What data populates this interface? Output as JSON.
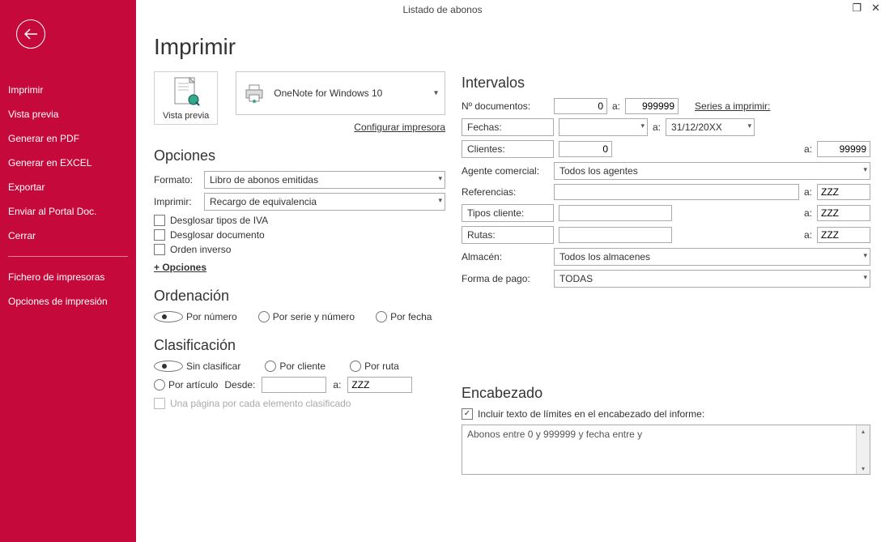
{
  "window": {
    "title": "Listado de abonos"
  },
  "sidebar": {
    "items": [
      "Imprimir",
      "Vista previa",
      "Generar en PDF",
      "Generar en EXCEL",
      "Exportar",
      "Enviar al Portal Doc.",
      "Cerrar"
    ],
    "secondary": [
      "Fichero de impresoras",
      "Opciones de impresión"
    ]
  },
  "page": {
    "title": "Imprimir",
    "preview_label": "Vista previa",
    "printer_name": "OneNote for Windows 10",
    "configure_printer": "Configurar impresora"
  },
  "opciones": {
    "title": "Opciones",
    "formato_label": "Formato:",
    "formato_value": "Libro de abonos emitidas",
    "imprimir_label": "Imprimir:",
    "imprimir_value": "Recargo de equivalencia",
    "chk1": "Desglosar tipos de IVA",
    "chk2": "Desglosar documento",
    "chk3": "Orden inverso",
    "more": "+ Opciones"
  },
  "ordenacion": {
    "title": "Ordenación",
    "r1": "Por número",
    "r2": "Por serie y número",
    "r3": "Por fecha"
  },
  "clasificacion": {
    "title": "Clasificación",
    "r1": "Sin clasificar",
    "r2": "Por cliente",
    "r3": "Por ruta",
    "r4": "Por artículo",
    "desde": "Desde:",
    "a": "a:",
    "hasta_val": "ZZZ",
    "chk_page": "Una página por cada elemento clasificado"
  },
  "intervalos": {
    "title": "Intervalos",
    "ndoc_label": "Nº documentos:",
    "ndoc_from": "0",
    "ndoc_to": "999999",
    "series_link": "Series a imprimir:",
    "fechas_label": "Fechas:",
    "fechas_to": "31/12/20XX",
    "clientes_label": "Clientes:",
    "clientes_from": "0",
    "clientes_to": "99999",
    "agente_label": "Agente comercial:",
    "agente_value": "Todos los agentes",
    "ref_label": "Referencias:",
    "ref_to": "ZZZ",
    "tipos_label": "Tipos cliente:",
    "tipos_to": "ZZZ",
    "rutas_label": "Rutas:",
    "rutas_to": "ZZZ",
    "almacen_label": "Almacén:",
    "almacen_value": "Todos los almacenes",
    "forma_label": "Forma de pago:",
    "forma_value": "TODAS",
    "a": "a:"
  },
  "encabezado": {
    "title": "Encabezado",
    "chk": "Incluir texto de límites en el encabezado del informe:",
    "text": "Abonos entre 0 y 999999 y fecha entre  y"
  }
}
